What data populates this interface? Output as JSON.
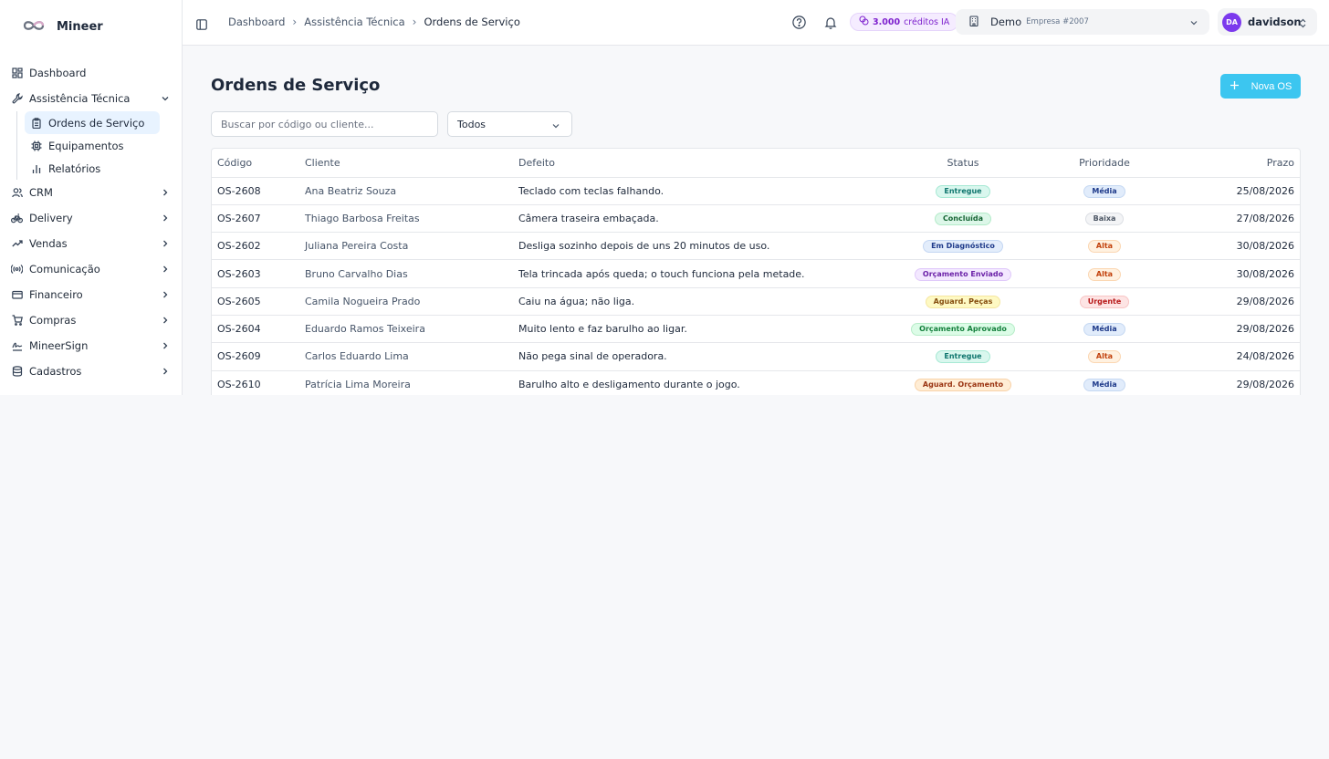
{
  "brand": {
    "name": "Mineer"
  },
  "sidebar": {
    "items": [
      {
        "label": "Dashboard",
        "icon": "dashboard-icon"
      },
      {
        "label": "Assistência Técnica",
        "icon": "wrench-icon",
        "expanded": true,
        "children": [
          {
            "label": "Ordens de Serviço",
            "icon": "clipboard-icon",
            "active": true
          },
          {
            "label": "Equipamentos",
            "icon": "cpu-icon"
          },
          {
            "label": "Relatórios",
            "icon": "bar-chart-icon"
          }
        ]
      },
      {
        "label": "CRM",
        "icon": "users-icon"
      },
      {
        "label": "Delivery",
        "icon": "bike-icon"
      },
      {
        "label": "Vendas",
        "icon": "trending-up-icon"
      },
      {
        "label": "Comunicação",
        "icon": "radio-icon"
      },
      {
        "label": "Financeiro",
        "icon": "credit-card-icon"
      },
      {
        "label": "Compras",
        "icon": "cart-icon"
      },
      {
        "label": "MineerSign",
        "icon": "signature-icon"
      },
      {
        "label": "Cadastros",
        "icon": "database-icon"
      }
    ]
  },
  "topbar": {
    "breadcrumb": [
      "Dashboard",
      "Assistência Técnica",
      "Ordens de Serviço"
    ],
    "credits_value": "3.000",
    "credits_label": "créditos IA",
    "company_name": "Demo",
    "company_id": "Empresa #2007",
    "user_initials": "DA",
    "user_name": "davidson"
  },
  "main": {
    "title": "Ordens de Serviço",
    "new_button": "Nova OS",
    "search_placeholder": "Buscar por código ou cliente...",
    "filter_value": "Todos",
    "columns": [
      "Código",
      "Cliente",
      "Defeito",
      "Status",
      "Prioridade",
      "Prazo"
    ],
    "rows": [
      {
        "code": "OS-2608",
        "client": "Ana Beatriz Souza",
        "defect": "Teclado com teclas falhando.",
        "status": "Entregue",
        "priority": "Média",
        "due": "25/08/2026"
      },
      {
        "code": "OS-2607",
        "client": "Thiago Barbosa Freitas",
        "defect": "Câmera traseira embaçada.",
        "status": "Concluída",
        "priority": "Baixa",
        "due": "27/08/2026"
      },
      {
        "code": "OS-2602",
        "client": "Juliana Pereira Costa",
        "defect": "Desliga sozinho depois de uns 20 minutos de uso.",
        "status": "Em Diagnóstico",
        "priority": "Alta",
        "due": "30/08/2026"
      },
      {
        "code": "OS-2603",
        "client": "Bruno Carvalho Dias",
        "defect": "Tela trincada após queda; o touch funciona pela metade.",
        "status": "Orçamento Enviado",
        "priority": "Alta",
        "due": "30/08/2026"
      },
      {
        "code": "OS-2605",
        "client": "Camila Nogueira Prado",
        "defect": "Caiu na água; não liga.",
        "status": "Aguard. Peças",
        "priority": "Urgente",
        "due": "29/08/2026"
      },
      {
        "code": "OS-2604",
        "client": "Eduardo Ramos Teixeira",
        "defect": "Muito lento e faz barulho ao ligar.",
        "status": "Orçamento Aprovado",
        "priority": "Média",
        "due": "29/08/2026"
      },
      {
        "code": "OS-2609",
        "client": "Carlos Eduardo Lima",
        "defect": "Não pega sinal de operadora.",
        "status": "Entregue",
        "priority": "Alta",
        "due": "24/08/2026"
      },
      {
        "code": "OS-2610",
        "client": "Patrícia Lima Moreira",
        "defect": "Barulho alto e desligamento durante o jogo.",
        "status": "Aguard. Orçamento",
        "priority": "Média",
        "due": "29/08/2026"
      }
    ]
  },
  "colors": {
    "accent": "#3cc6f0",
    "status": {
      "Entregue": [
        "#d9f7ee",
        "#0f766e",
        "#a7e9d4"
      ],
      "Concluída": [
        "#ddf7e9",
        "#166534",
        "#b3ebc9"
      ],
      "Em Diagnóstico": [
        "#e3edfb",
        "#1e3a8a",
        "#c4d7f3"
      ],
      "Orçamento Enviado": [
        "#f3e8ff",
        "#6b21a8",
        "#e0c9fa"
      ],
      "Aguard. Peças": [
        "#fef9c3",
        "#854d0e",
        "#f5e6a0"
      ],
      "Orçamento Aprovado": [
        "#dcfce7",
        "#15803d",
        "#b7ecc8"
      ],
      "Aguard. Orçamento": [
        "#ffedd5",
        "#9a3412",
        "#f8d2a8"
      ]
    },
    "priority": {
      "Média": [
        "#e1ecfb",
        "#1e3a8a",
        "#c5d8f2"
      ],
      "Baixa": [
        "#f3f4f6",
        "#4b5563",
        "#dcdfe4"
      ],
      "Alta": [
        "#fff1e0",
        "#c2410c",
        "#fbd7b3"
      ],
      "Urgente": [
        "#fde4e4",
        "#b91c1c",
        "#f8c5c5"
      ]
    }
  }
}
